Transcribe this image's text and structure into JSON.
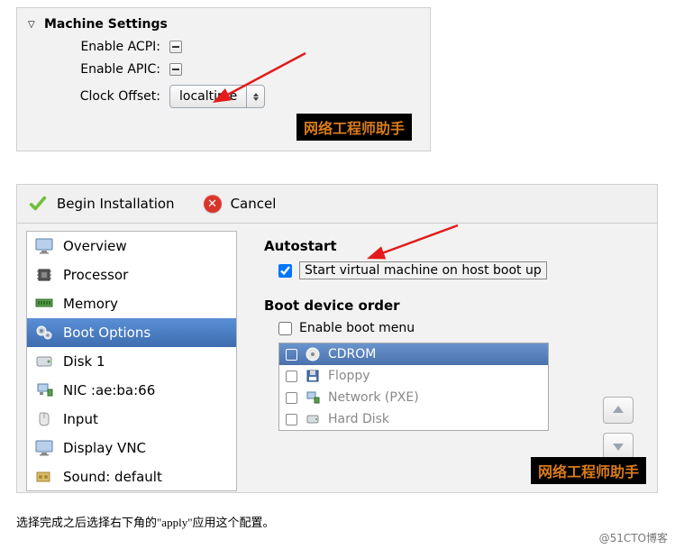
{
  "panel1": {
    "header": "Machine Settings",
    "enable_acpi": "Enable ACPI:",
    "enable_apic": "Enable APIC:",
    "clock_offset": "Clock Offset:",
    "clock_value": "localtime"
  },
  "watermark": "网络工程师助手",
  "toolbar": {
    "begin": "Begin Installation",
    "cancel": "Cancel"
  },
  "sidebar": {
    "items": [
      {
        "label": "Overview"
      },
      {
        "label": "Processor"
      },
      {
        "label": "Memory"
      },
      {
        "label": "Boot Options"
      },
      {
        "label": "Disk 1"
      },
      {
        "label": "NIC :ae:ba:66"
      },
      {
        "label": "Input"
      },
      {
        "label": "Display VNC"
      },
      {
        "label": "Sound: default"
      }
    ]
  },
  "right": {
    "autostart_h": "Autostart",
    "autostart_label": "Start virtual machine on host boot up",
    "boot_h": "Boot device order",
    "enable_boot_menu": "Enable boot menu",
    "devices": [
      {
        "label": "CDROM"
      },
      {
        "label": "Floppy"
      },
      {
        "label": "Network (PXE)"
      },
      {
        "label": "Hard Disk"
      }
    ]
  },
  "caption": "选择完成之后选择右下角的\"apply\"应用这个配置。",
  "credit": "@51CTO博客"
}
